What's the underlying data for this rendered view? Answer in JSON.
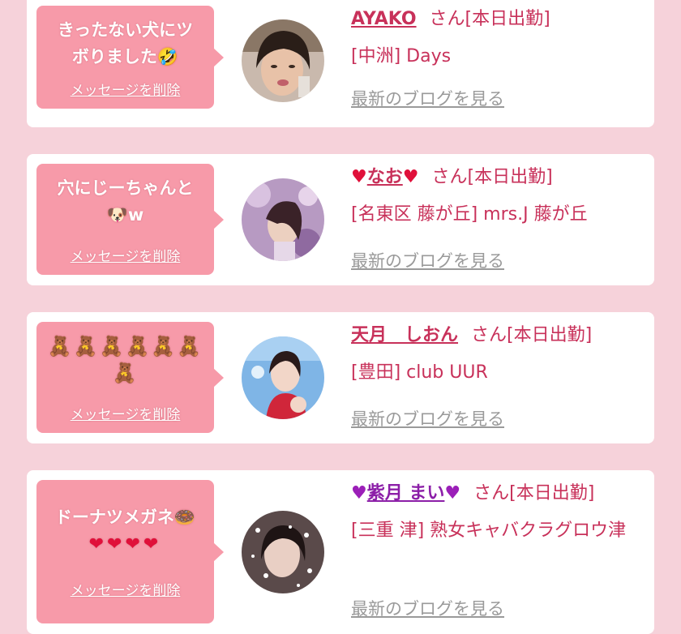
{
  "common": {
    "delete_label": "メッセージを削除",
    "blog_label": "最新のブログを見る",
    "honorific": "さん[本日出勤]"
  },
  "cards": [
    {
      "message_line1": "きったない犬にツ",
      "message_line2": "ボりました🤣",
      "name": "AYAKO",
      "shop": "[中洲] Days"
    },
    {
      "message_line1": "穴にじーちゃんと",
      "message_line2": "🐶w",
      "name": "なお",
      "shop": "[名東区 藤が丘] mrs.J 藤が丘"
    },
    {
      "message_line1": "🧸🧸🧸🧸🧸🧸",
      "message_line2": "🧸",
      "name": "天月　しおん",
      "shop": "[豊田] club UUR"
    },
    {
      "message_line1": "ドーナツメガネ🍩",
      "message_line2": "❤❤❤❤",
      "name": "紫月 まい",
      "shop": "[三重 津] 熟女キャバクラグロウ津"
    }
  ],
  "colors": {
    "background": "#f6d2da",
    "bubble": "#f79aa9",
    "name": "#c8315a",
    "blog_link": "#9a9a9a",
    "heart_red": "#e0103a",
    "heart_purple": "#9b1fb8"
  },
  "icons": [
    "heart-icon",
    "avatar-photo"
  ]
}
